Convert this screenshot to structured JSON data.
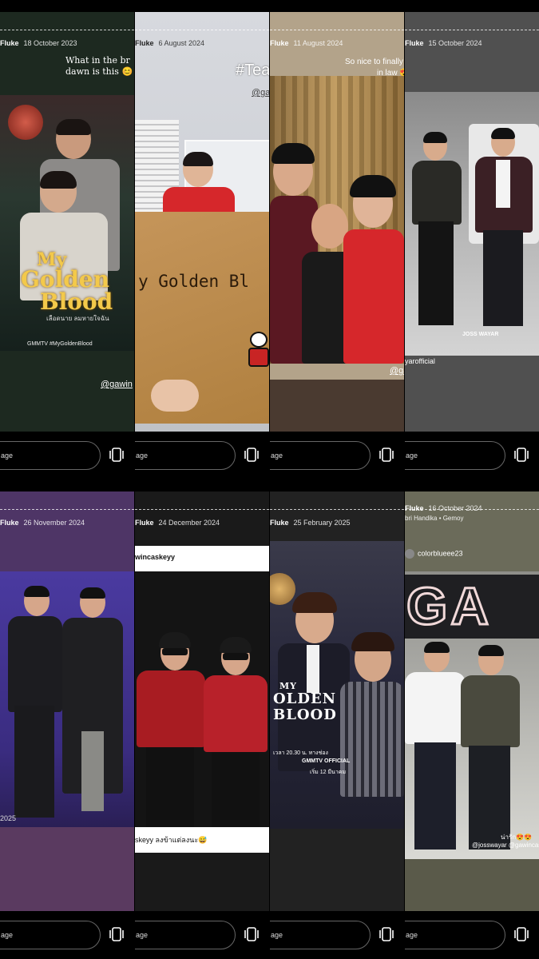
{
  "stories": [
    {
      "user": "Fluke",
      "date": "18 October 2023",
      "caption_line1": "What in the br",
      "caption_line2": "dawn is this",
      "caption_emoji": "😊",
      "poster_title_1": "My",
      "poster_title_2": "Golden",
      "poster_title_3": "Blood",
      "poster_thai": "เลือดนาย ลมหายใจฉัน",
      "poster_tag": "GMMTV #MyGoldenBlood",
      "mention": "@gawin",
      "reply_label": "age"
    },
    {
      "user": "Fluke",
      "date": "6 August 2024",
      "caption": "#Team",
      "mention": "@gaw",
      "envelope_text": "y Golden Bl",
      "reply_label": "age"
    },
    {
      "user": "Fluke",
      "date": "11 August 2024",
      "caption_line1": "So nice to finally me",
      "caption_line2": "in law",
      "caption_emoji": "😍",
      "mention": "@ga",
      "reply_label": "age"
    },
    {
      "user": "Fluke",
      "date": "15 October 2024",
      "watermark": "JOSS WAYAR",
      "mention": "yarofficial",
      "reply_label": "age"
    },
    {
      "user": "Fluke",
      "date": "26 November 2024",
      "year_tag": "2025",
      "reply_label": "age"
    },
    {
      "user": "Fluke",
      "date": "24 December 2024",
      "top_mention": "wincaskeyy",
      "bottom_caption": "skeyy ลงข้าแต่ลงนะ",
      "bottom_emoji": "😅",
      "reply_label": "age"
    },
    {
      "user": "Fluke",
      "date": "25 February 2025",
      "poster_title_1": "MY",
      "poster_title_2": "OLDEN",
      "poster_title_3": "BLOOD",
      "air_info": "เวลา 20.30 น. ทางช่อง",
      "gmmtv_official": "GMMTV OFFICIAL",
      "start_date": "เริ่ม 12 มีนาคม",
      "reply_label": "age"
    },
    {
      "user": "Fluke",
      "date": "16 October 2024",
      "music": "bri Handika • Gemoy",
      "top_mention": "colorblueee23",
      "sign_text": "GA",
      "bottom_caption": "น่ารัก",
      "bottom_emoji": "😍😍",
      "bottom_mentions": "@josswayar @gawincas",
      "reply_label": "age"
    }
  ],
  "colors": {
    "gold": "#f3c94a",
    "red_shirt": "#d6272b",
    "dark_suit": "#1c1c20",
    "purple_bg": "#4e3566",
    "beige_bg": "#b3a38a",
    "green_dark": "#1d2920"
  },
  "icons": {
    "share": "share-icon"
  }
}
